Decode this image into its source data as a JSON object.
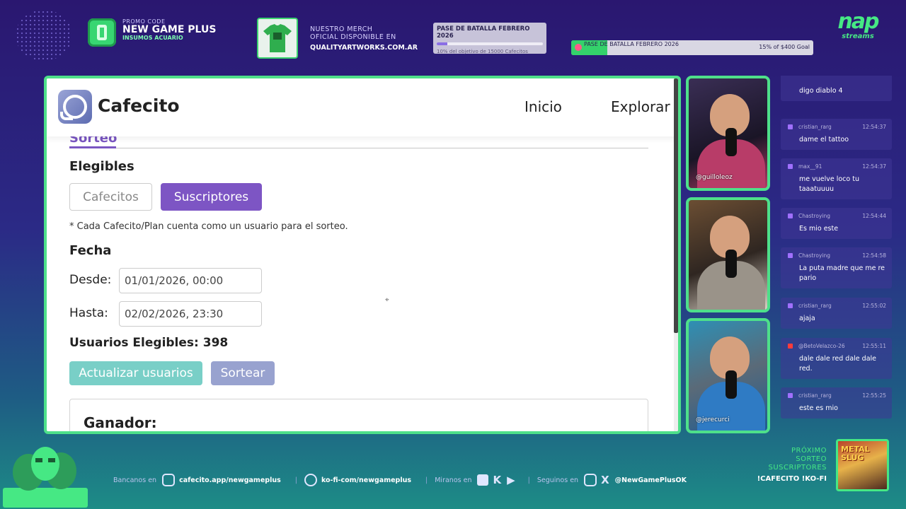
{
  "banner": {
    "promo_small": "PROMO CODE",
    "promo_big": "NEW GAME PLUS",
    "promo_sub": "INSUMOS ACUARIO",
    "merch_line1": "NUESTRO MERCH",
    "merch_line2": "OFICIAL DISPONIBLE EN",
    "merch_url": "QUALITYARTWORKS.COM.AR",
    "battle_pass_1": {
      "title": "PASE DE BATALLA FEBRERO 2026",
      "sub": "10% del objetivo de 15000 Cafecitos",
      "progress": 0.1
    },
    "battle_pass_2": {
      "title": "PASE DE BATALLA FEBRERO 2026",
      "goal": "15% of $400 Goal",
      "progress": 0.15
    },
    "logo_text": "nap",
    "logo_sub": "streams"
  },
  "browser": {
    "brand": "Cafecito",
    "nav": {
      "inicio": "Inicio",
      "explorar": "Explorar"
    },
    "tab_label": "Sorteo",
    "elegibles_heading": "Elegibles",
    "btn_cafecitos": "Cafecitos",
    "btn_suscriptores": "Suscriptores",
    "note": "* Cada Cafecito/Plan cuenta como un usuario para el sorteo.",
    "fecha_heading": "Fecha",
    "desde_label": "Desde:",
    "desde_value": "01/01/2026, 00:00",
    "hasta_label": "Hasta:",
    "hasta_value": "02/02/2026, 23:30",
    "usuarios_elegibles": "Usuarios Elegibles: 398",
    "btn_actualizar": "Actualizar usuarios",
    "btn_sortear": "Sortear",
    "ganador": "Ganador:"
  },
  "cams": {
    "cam1": "@guilloleoz",
    "cam2": "",
    "cam3": "@jerecurci"
  },
  "chat": [
    {
      "user": "",
      "time": "",
      "text": "digo diablo 4",
      "platform": "twitch"
    },
    {
      "user": "cristian_rarg",
      "time": "12:54:37",
      "text": "dame el tattoo",
      "platform": "twitch"
    },
    {
      "user": "max__91",
      "time": "12:54:37",
      "text": "me vuelve loco tu taaatuuuu",
      "platform": "twitch"
    },
    {
      "user": "Chastroying",
      "time": "12:54:44",
      "text": "Es mio este",
      "platform": "twitch"
    },
    {
      "user": "Chastroying",
      "time": "12:54:58",
      "text": "La puta madre que me re pario",
      "platform": "twitch"
    },
    {
      "user": "cristian_rarg",
      "time": "12:55:02",
      "text": "ajaja",
      "platform": "twitch"
    },
    {
      "user": "@BetoVelazco-26",
      "time": "12:55:11",
      "text": "dale dale red dale dale red.",
      "platform": "youtube"
    },
    {
      "user": "cristian_rarg",
      "time": "12:55:25",
      "text": "este es mio",
      "platform": "twitch"
    }
  ],
  "footer": {
    "bancanos_label": "Bancanos en",
    "cafecito_url": "cafecito.app/newgameplus",
    "kofi_url": "ko-fi-com/newgameplus",
    "miranos_label": "Miranos en",
    "seguinos_label": "Seguinos en",
    "social_handle": "@NewGamePlusOK",
    "proximo_1": "PRÓXIMO",
    "proximo_2": "SORTEO",
    "proximo_3": "SUSCRIPTORES",
    "commands": "!CAFECITO !KO-FI",
    "game_title": "METAL SLUG"
  }
}
